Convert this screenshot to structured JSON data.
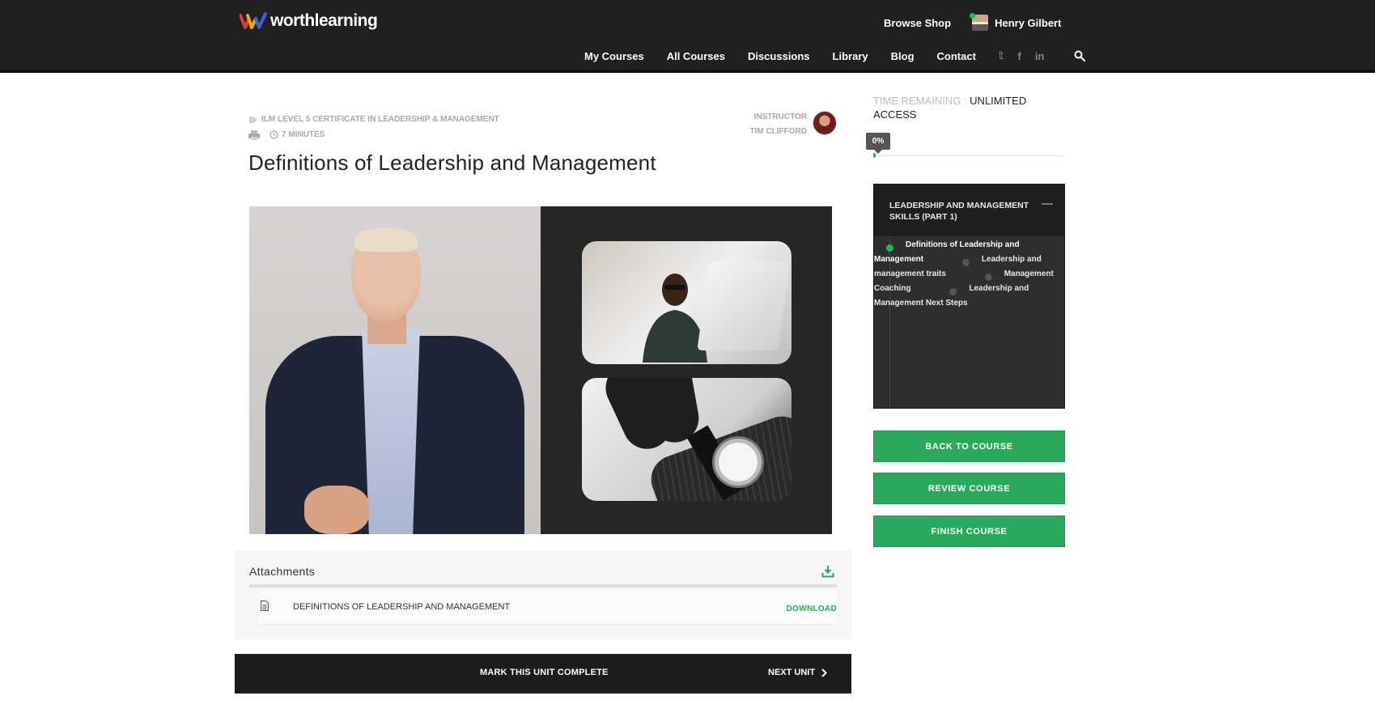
{
  "header": {
    "logo_text": "worthlearning",
    "browse_shop": "Browse Shop",
    "user_name": "Henry Gilbert",
    "nav": [
      "My Courses",
      "All Courses",
      "Discussions",
      "Library",
      "Blog",
      "Contact"
    ],
    "social": [
      "twitter-icon",
      "facebook-icon",
      "linkedin-icon"
    ],
    "social_glyphs": [
      "𝕥",
      "f",
      "in"
    ]
  },
  "unit": {
    "course_tag": "ILM LEVEL 5 CERTIFICATE IN LEADERSHIP & MANAGEMENT",
    "duration": "7 MINUTES",
    "instructor_label": "INSTRUCTOR",
    "instructor_name": "TIM CLIFFORD",
    "title": "Definitions of Leadership and Management"
  },
  "attachments": {
    "title": "Attachments",
    "items": [
      {
        "name": "DEFINITIONS OF LEADERSHIP AND MANAGEMENT",
        "action": "DOWNLOAD"
      }
    ]
  },
  "unit_bar": {
    "mark_complete": "MARK THIS UNIT COMPLETE",
    "next_unit": "NEXT UNIT"
  },
  "sidebar": {
    "time_label": "TIME REMAINING : ",
    "time_value": "UNLIMITED ACCESS",
    "progress_label": "0%",
    "progress_value": 0,
    "section_title": "LEADERSHIP AND MANAGEMENT SKILLS (PART 1)",
    "units": [
      {
        "label": "Definitions of Leadership and Management",
        "active": true
      },
      {
        "label": "Leadership and management traits",
        "active": false
      },
      {
        "label": "Management Coaching",
        "active": false
      },
      {
        "label": "Leadership and Management Next Steps",
        "active": false
      }
    ],
    "buttons": {
      "back": "BACK TO COURSE",
      "review": "REVIEW COURSE",
      "finish": "FINISH COURSE"
    }
  },
  "colors": {
    "header_bg": "#202020",
    "accent_green": "#2aa85b",
    "curriculum_bg": "#2e2e2e"
  }
}
